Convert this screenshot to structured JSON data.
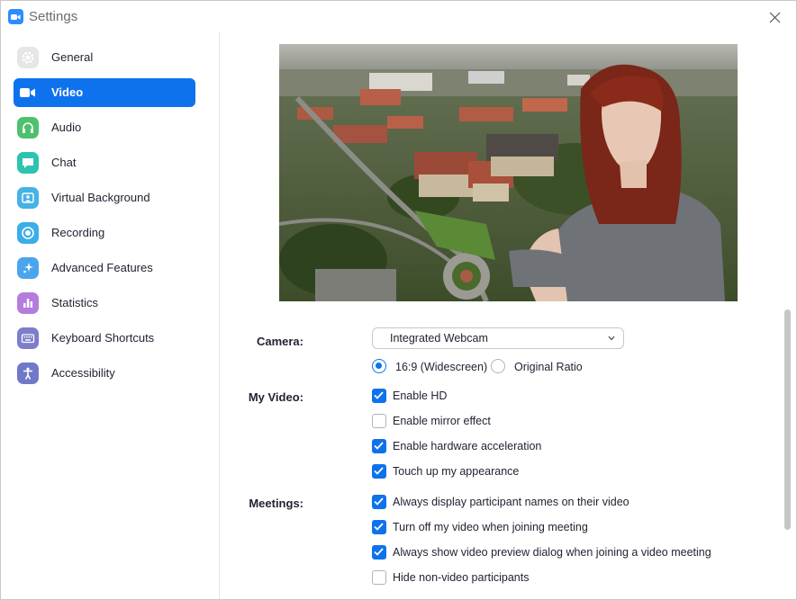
{
  "window": {
    "title": "Settings"
  },
  "sidebar": {
    "items": [
      {
        "label": "General",
        "icon": "gear-icon",
        "color": "#e8e8e8",
        "active": false
      },
      {
        "label": "Video",
        "icon": "video-camera-icon",
        "color": "#0e72ed",
        "active": true
      },
      {
        "label": "Audio",
        "icon": "headphones-icon",
        "color": "#4fc16e",
        "active": false
      },
      {
        "label": "Chat",
        "icon": "chat-bubble-icon",
        "color": "#2dc3b0",
        "active": false
      },
      {
        "label": "Virtual Background",
        "icon": "person-card-icon",
        "color": "#47b2e6",
        "active": false
      },
      {
        "label": "Recording",
        "icon": "record-icon",
        "color": "#3aaee8",
        "active": false
      },
      {
        "label": "Advanced Features",
        "icon": "sparkle-icon",
        "color": "#4aa5ed",
        "active": false
      },
      {
        "label": "Statistics",
        "icon": "bar-chart-icon",
        "color": "#b47ddc",
        "active": false
      },
      {
        "label": "Keyboard Shortcuts",
        "icon": "keyboard-icon",
        "color": "#7c7ec9",
        "active": false
      },
      {
        "label": "Accessibility",
        "icon": "accessibility-icon",
        "color": "#6f79c7",
        "active": false
      }
    ]
  },
  "video": {
    "camera_label": "Camera:",
    "camera_value": "Integrated Webcam",
    "ratio_options": [
      {
        "label": "16:9 (Widescreen)",
        "checked": true
      },
      {
        "label": "Original Ratio",
        "checked": false
      }
    ],
    "my_video_label": "My Video:",
    "my_video_options": [
      {
        "label": "Enable HD",
        "checked": true
      },
      {
        "label": "Enable mirror effect",
        "checked": false
      },
      {
        "label": "Enable hardware acceleration",
        "checked": true
      },
      {
        "label": "Touch up my appearance",
        "checked": true
      }
    ],
    "meetings_label": "Meetings:",
    "meetings_options": [
      {
        "label": "Always display participant names on their video",
        "checked": true
      },
      {
        "label": "Turn off my video when joining meeting",
        "checked": true
      },
      {
        "label": "Always show video preview dialog when joining a video meeting",
        "checked": true
      },
      {
        "label": "Hide non-video participants",
        "checked": false
      }
    ]
  },
  "colors": {
    "accent": "#0e72ed",
    "brand": "#2d8cff"
  }
}
